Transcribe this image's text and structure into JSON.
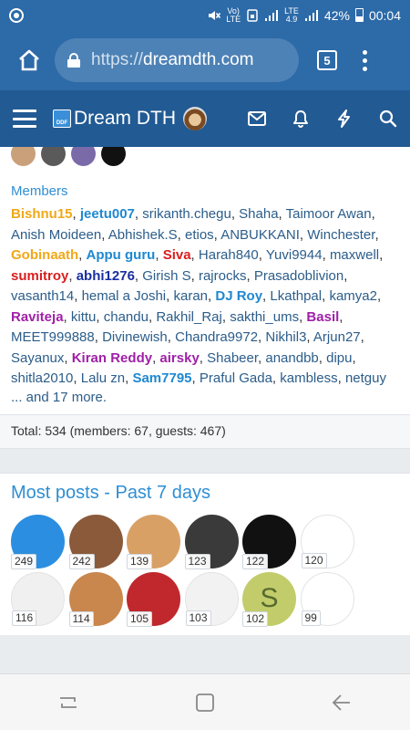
{
  "status_bar": {
    "volte_top": "Vo)",
    "volte_bottom": "LTE",
    "lte_top": "LTE",
    "lte_bottom": "4.9",
    "battery": "42%",
    "time": "00:04"
  },
  "browser": {
    "url_scheme": "https://",
    "url_host": "dreamdth.com",
    "tab_count": "5"
  },
  "site": {
    "logo_text": "DDF",
    "title": "Dream DTH"
  },
  "members_section": {
    "heading": "Members",
    "members": [
      {
        "name": "Bishnu15",
        "color": "#f0a818",
        "bold": true
      },
      {
        "name": "jeetu007",
        "color": "#1e88d0",
        "bold": true
      },
      {
        "name": "srikanth.chegu",
        "color": "",
        "bold": false
      },
      {
        "name": "Shaha",
        "color": "",
        "bold": false
      },
      {
        "name": "Taimoor Awan",
        "color": "",
        "bold": false
      },
      {
        "name": "Anish Moideen",
        "color": "",
        "bold": false
      },
      {
        "name": "Abhishek.S",
        "color": "",
        "bold": false
      },
      {
        "name": "etios",
        "color": "",
        "bold": false
      },
      {
        "name": "ANBUKKANI",
        "color": "",
        "bold": false
      },
      {
        "name": "Winchester",
        "color": "",
        "bold": false
      },
      {
        "name": "Gobinaath",
        "color": "#f0a818",
        "bold": true
      },
      {
        "name": "Appu guru",
        "color": "#1e88d0",
        "bold": true
      },
      {
        "name": "Siva",
        "color": "#d81f1f",
        "bold": true
      },
      {
        "name": "Harah840",
        "color": "",
        "bold": false
      },
      {
        "name": "Yuvi9944",
        "color": "",
        "bold": false
      },
      {
        "name": "maxwell",
        "color": "",
        "bold": false
      },
      {
        "name": "sumitroy",
        "color": "#d81f1f",
        "bold": true
      },
      {
        "name": "abhi1276",
        "color": "#1a2fa0",
        "bold": true
      },
      {
        "name": "Girish S",
        "color": "",
        "bold": false
      },
      {
        "name": "rajrocks",
        "color": "",
        "bold": false
      },
      {
        "name": "Prasadoblivion",
        "color": "",
        "bold": false
      },
      {
        "name": "vasanth14",
        "color": "",
        "bold": false
      },
      {
        "name": "hemal a Joshi",
        "color": "",
        "bold": false
      },
      {
        "name": "karan",
        "color": "",
        "bold": false
      },
      {
        "name": "DJ Roy",
        "color": "#1e88d0",
        "bold": true
      },
      {
        "name": "Lkathpal",
        "color": "",
        "bold": false
      },
      {
        "name": "kamya2",
        "color": "",
        "bold": false
      },
      {
        "name": "Raviteja",
        "color": "#a020a8",
        "bold": true
      },
      {
        "name": "kittu",
        "color": "",
        "bold": false
      },
      {
        "name": "chandu",
        "color": "",
        "bold": false
      },
      {
        "name": "Rakhil_Raj",
        "color": "",
        "bold": false
      },
      {
        "name": "sakthi_ums",
        "color": "",
        "bold": false
      },
      {
        "name": "Basil",
        "color": "#a020a8",
        "bold": true
      },
      {
        "name": "MEET999888",
        "color": "",
        "bold": false
      },
      {
        "name": "Divinewish",
        "color": "",
        "bold": false
      },
      {
        "name": "Chandra9972",
        "color": "",
        "bold": false
      },
      {
        "name": "Nikhil3",
        "color": "",
        "bold": false
      },
      {
        "name": "Arjun27",
        "color": "",
        "bold": false
      },
      {
        "name": "Sayanux",
        "color": "",
        "bold": false
      },
      {
        "name": "Kiran Reddy",
        "color": "#a020a8",
        "bold": true
      },
      {
        "name": "airsky",
        "color": "#a020a8",
        "bold": true
      },
      {
        "name": "Shabeer",
        "color": "",
        "bold": false
      },
      {
        "name": "anandbb",
        "color": "",
        "bold": false
      },
      {
        "name": "dipu",
        "color": "",
        "bold": false
      },
      {
        "name": "shitla2010",
        "color": "",
        "bold": false
      },
      {
        "name": "Lalu zn",
        "color": "",
        "bold": false
      },
      {
        "name": "Sam7795",
        "color": "#1e88d0",
        "bold": true
      },
      {
        "name": "Praful Gada",
        "color": "",
        "bold": false
      },
      {
        "name": "kambless",
        "color": "",
        "bold": false
      },
      {
        "name": "netguy",
        "color": "",
        "bold": false
      }
    ],
    "more_text": "... and 17 more.",
    "total_text": "Total: 534 (members: 67, guests: 467)"
  },
  "most_posts": {
    "heading": "Most posts - Past 7 days",
    "users": [
      {
        "count": "249",
        "icon": "ddf-logo-avatar",
        "bg": "#2b8ee0",
        "letter": ""
      },
      {
        "count": "242",
        "icon": "man-photo-avatar",
        "bg": "#8a5a3a",
        "letter": ""
      },
      {
        "count": "139",
        "icon": "saint-photo-avatar",
        "bg": "#d9a066",
        "letter": ""
      },
      {
        "count": "123",
        "icon": "india-flag-avatar",
        "bg": "#3a3a3a",
        "letter": ""
      },
      {
        "count": "122",
        "icon": "biohazard-avatar",
        "bg": "#111111",
        "letter": ""
      },
      {
        "count": "120",
        "icon": "cartoon-man-avatar",
        "bg": "#ffffff",
        "letter": ""
      },
      {
        "count": "116",
        "icon": "cartoon-doctor-avatar",
        "bg": "#f0f0f0",
        "letter": ""
      },
      {
        "count": "114",
        "icon": "puppy-avatar",
        "bg": "#c9864d",
        "letter": ""
      },
      {
        "count": "105",
        "icon": "spiderman-avatar",
        "bg": "#c0282d",
        "letter": ""
      },
      {
        "count": "103",
        "icon": "kung-fu-panda-avatar",
        "bg": "#f2f2f2",
        "letter": ""
      },
      {
        "count": "102",
        "icon": "letter-s-avatar",
        "bg": "#c2cc6a",
        "letter": "S"
      },
      {
        "count": "99",
        "icon": "pokemon-trainer-avatar",
        "bg": "#ffffff",
        "letter": ""
      }
    ]
  },
  "colors": {
    "browser_blue": "#2c6aa8",
    "header_blue": "#225a93",
    "link_blue": "#2b5d8a",
    "heading_blue": "#2f8ed3"
  }
}
